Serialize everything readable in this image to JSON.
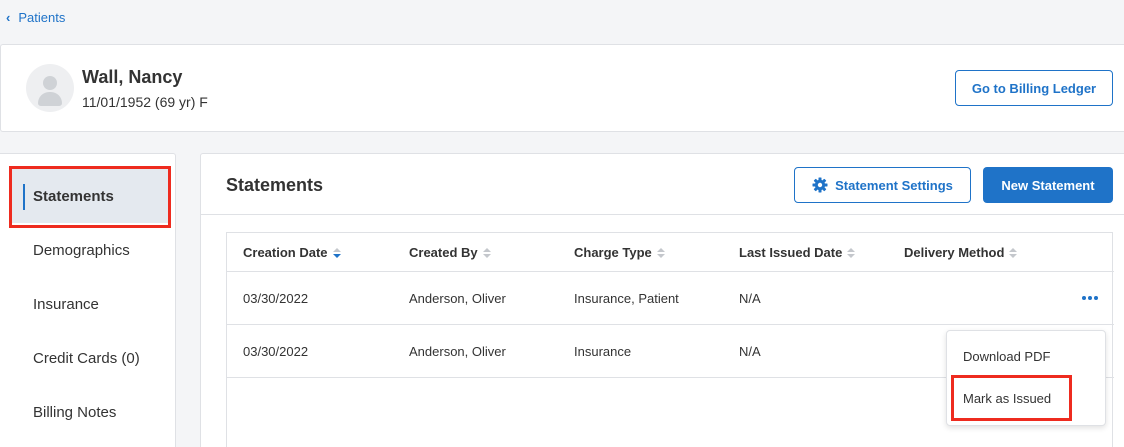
{
  "breadcrumb": {
    "label": "Patients"
  },
  "patient": {
    "name": "Wall, Nancy",
    "dob": "11/01/1952 (69 yr) F",
    "ledger_button": "Go to Billing Ledger"
  },
  "sidebar": {
    "items": [
      {
        "label": "Statements",
        "active": true
      },
      {
        "label": "Demographics"
      },
      {
        "label": "Insurance"
      },
      {
        "label": "Credit Cards (0)"
      },
      {
        "label": "Billing Notes"
      }
    ]
  },
  "main": {
    "title": "Statements",
    "settings_button": "Statement Settings",
    "new_button": "New Statement",
    "table": {
      "columns": [
        "Creation Date",
        "Created By",
        "Charge Type",
        "Last Issued Date",
        "Delivery Method"
      ],
      "sorted_column": "Creation Date",
      "rows": [
        [
          "03/30/2022",
          "Anderson, Oliver",
          "Insurance, Patient",
          "N/A",
          ""
        ],
        [
          "03/30/2022",
          "Anderson, Oliver",
          "Insurance",
          "N/A",
          ""
        ]
      ]
    }
  },
  "row_menu": {
    "items": [
      "Download PDF",
      "Mark as Issued"
    ]
  },
  "colors": {
    "accent": "#1f73c8",
    "highlight": "#ee2b1f"
  }
}
